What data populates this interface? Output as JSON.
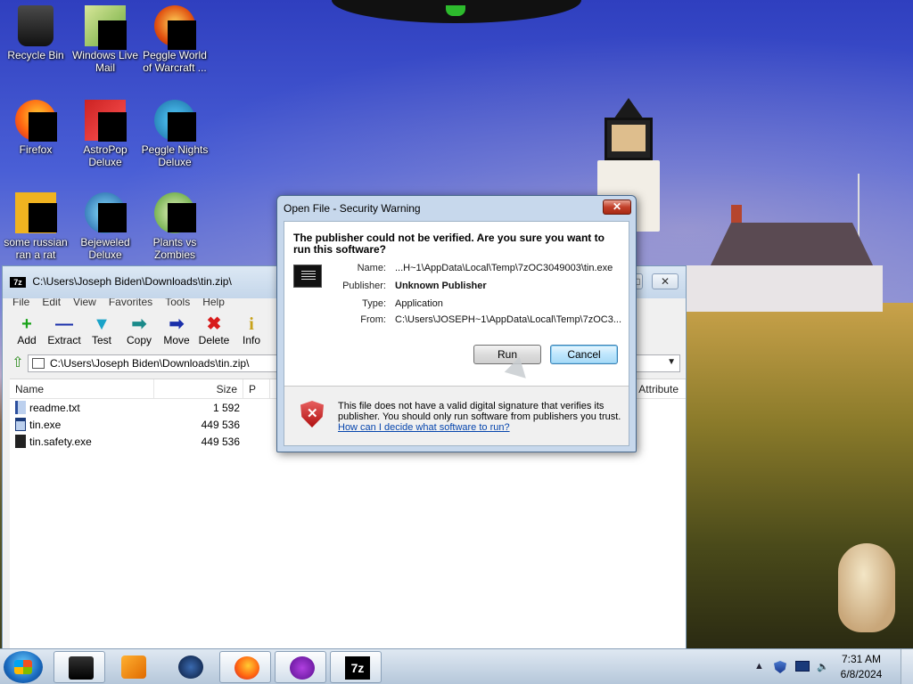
{
  "desktop": {
    "icons": [
      {
        "label": "Recycle Bin",
        "icon": "recycle-bin-icon"
      },
      {
        "label": "Windows Live Mail",
        "icon": "mail-icon"
      },
      {
        "label": "Peggle World of Warcraft ...",
        "icon": "peggle-icon"
      },
      {
        "label": "Firefox",
        "icon": "firefox-icon"
      },
      {
        "label": "AstroPop Deluxe",
        "icon": "astropop-icon"
      },
      {
        "label": "Peggle Nights Deluxe",
        "icon": "peggle-nights-icon"
      },
      {
        "label": "some russian ran a rat",
        "icon": "ebook-icon"
      },
      {
        "label": "Bejeweled Deluxe",
        "icon": "bejeweled-icon"
      },
      {
        "label": "Plants vs Zombies",
        "icon": "pvz-icon"
      }
    ]
  },
  "sevenzip": {
    "title": "C:\\Users\\Joseph Biden\\Downloads\\tin.zip\\",
    "app_badge": "7z",
    "menu": [
      "File",
      "Edit",
      "View",
      "Favorites",
      "Tools",
      "Help"
    ],
    "toolbar": [
      {
        "label": "Add",
        "glyph": "+",
        "color": "#1aa31a"
      },
      {
        "label": "Extract",
        "glyph": "—",
        "color": "#1a2faa"
      },
      {
        "label": "Test",
        "glyph": "▼",
        "color": "#1aa3c8"
      },
      {
        "label": "Copy",
        "glyph": "➡",
        "color": "#1a8a8a"
      },
      {
        "label": "Move",
        "glyph": "➡",
        "color": "#1a2faa"
      },
      {
        "label": "Delete",
        "glyph": "✖",
        "color": "#d81a1a"
      },
      {
        "label": "Info",
        "glyph": "i",
        "color": "#c8a21a"
      }
    ],
    "address": "C:\\Users\\Joseph Biden\\Downloads\\tin.zip\\",
    "columns": {
      "name": "Name",
      "size": "Size",
      "p": "P",
      "attribute": "Attribute"
    },
    "files": [
      {
        "name": "readme.txt",
        "size": "1 592",
        "type": "txt"
      },
      {
        "name": "tin.exe",
        "size": "449 536",
        "type": "exe"
      },
      {
        "name": "tin.safety.exe",
        "size": "449 536",
        "type": "exe2"
      }
    ]
  },
  "dialog": {
    "title": "Open File - Security Warning",
    "close_label": "x",
    "question": "The publisher could not be verified.  Are you sure you want to run this software?",
    "fields": [
      {
        "label": "Name:",
        "value": "...H~1\\AppData\\Local\\Temp\\7zOC3049003\\tin.exe",
        "bold": false
      },
      {
        "label": "Publisher:",
        "value": "Unknown Publisher",
        "bold": true
      },
      {
        "label": "Type:",
        "value": "Application",
        "bold": false
      },
      {
        "label": "From:",
        "value": "C:\\Users\\JOSEPH~1\\AppData\\Local\\Temp\\7zOC3...",
        "bold": false
      }
    ],
    "run_label": "Run",
    "cancel_label": "Cancel",
    "warning_text": "This file does not have a valid digital signature that verifies its publisher.  You should only run software from publishers you trust.",
    "help_link": "How can I decide what software to run?"
  },
  "taskbar": {
    "apps": [
      "file-explorer-icon",
      "media-player-icon",
      "globe-icon",
      "firefox-icon",
      "game-icon",
      "sevenzip-icon"
    ],
    "active_app": "sevenzip-icon",
    "sevenzip_badge": "7z",
    "clock_time": "7:31 AM",
    "clock_date": "6/8/2024"
  }
}
